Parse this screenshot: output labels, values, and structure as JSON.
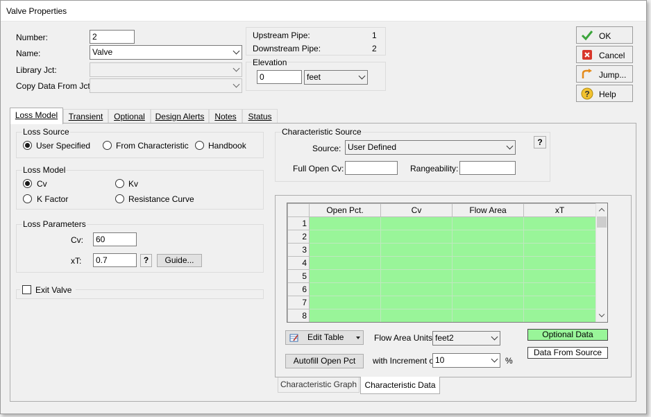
{
  "window": {
    "title": "Valve Properties"
  },
  "fields": {
    "number_label": "Number:",
    "number_value": "2",
    "name_label": "Name:",
    "name_value": "Valve",
    "library_label": "Library Jct:",
    "library_value": "",
    "copy_label": "Copy Data From Jct...",
    "copy_value": ""
  },
  "pipes": {
    "upstream_label": "Upstream Pipe:",
    "upstream_value": "1",
    "downstream_label": "Downstream Pipe:",
    "downstream_value": "2"
  },
  "elevation": {
    "title": "Elevation",
    "value": "0",
    "unit": "feet"
  },
  "side_buttons": {
    "ok": "OK",
    "cancel": "Cancel",
    "jump": "Jump...",
    "help": "Help"
  },
  "tabs": [
    {
      "label": "Loss Model"
    },
    {
      "label": "Transient"
    },
    {
      "label": "Optional"
    },
    {
      "label": "Design Alerts"
    },
    {
      "label": "Notes"
    },
    {
      "label": "Status"
    }
  ],
  "loss_source": {
    "title": "Loss Source",
    "options": [
      "User Specified",
      "From Characteristic",
      "Handbook"
    ],
    "selected": "User Specified"
  },
  "loss_model": {
    "title": "Loss Model",
    "options": [
      "Cv",
      "Kv",
      "K Factor",
      "Resistance Curve"
    ],
    "selected": "Cv"
  },
  "loss_parameters": {
    "title": "Loss Parameters",
    "cv_label": "Cv:",
    "cv_value": "60",
    "xt_label": "xT:",
    "xt_value": "0.7",
    "help_q": "?",
    "guide_label": "Guide..."
  },
  "exit_valve": {
    "label": "Exit Valve",
    "checked": false
  },
  "characteristic_source": {
    "title": "Characteristic Source",
    "source_label": "Source:",
    "source_value": "User Defined",
    "help_q": "?",
    "full_open_label": "Full Open Cv:",
    "full_open_value": "",
    "rangeability_label": "Rangeability:",
    "rangeability_value": ""
  },
  "table": {
    "headers": [
      "Open Pct.",
      "Cv",
      "Flow Area",
      "xT"
    ],
    "row_numbers": [
      "1",
      "2",
      "3",
      "4",
      "5",
      "6",
      "7",
      "8"
    ]
  },
  "table_controls": {
    "edit_table": "Edit Table",
    "flow_area_units_label": "Flow Area Units:",
    "flow_area_units_value": "feet2",
    "autofill": "Autofill Open Pct",
    "increment_label": "with Increment of",
    "increment_value": "10",
    "increment_unit": "%",
    "optional_data": "Optional Data",
    "data_from_source": "Data From Source"
  },
  "bottom_tabs": {
    "graph": "Characteristic Graph",
    "data": "Characteristic Data"
  },
  "colors": {
    "grid_green": "#99f599",
    "ok_check": "#3ca53c",
    "cancel_red": "#d8362b"
  }
}
